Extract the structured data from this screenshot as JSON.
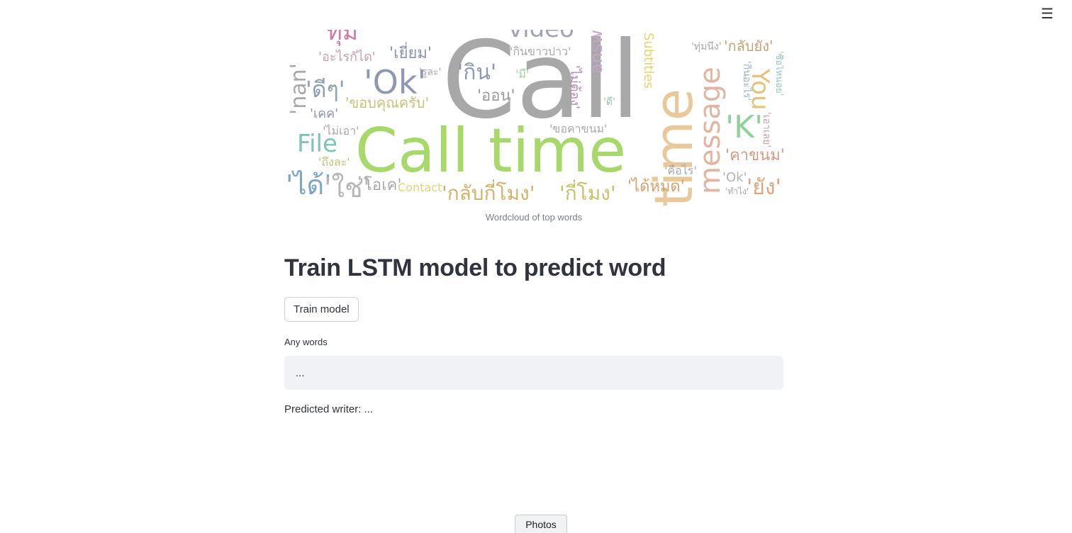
{
  "header": {
    "menu_icon": "hamburger-menu-icon",
    "menu_glyph": "☰"
  },
  "wordcloud": {
    "caption": "Wordcloud of top words",
    "words": [
      {
        "text": "Call",
        "color": "#a8a8a8"
      },
      {
        "text": "'Call",
        "color": "#b0b0b0"
      },
      {
        "text": "Call time",
        "color": "#a7d96a"
      },
      {
        "text": "time",
        "color": "#e9c89a"
      },
      {
        "text": "message",
        "color": "#e2b5a0"
      },
      {
        "text": "'Ok'",
        "color": "#8e98b0"
      },
      {
        "text": "File",
        "color": "#7fc3b9"
      },
      {
        "text": "'K'",
        "color": "#8fd19a"
      },
      {
        "text": "You",
        "color": "#e6c27a"
      },
      {
        "text": "video",
        "color": "#9ea4b6"
      },
      {
        "text": "answer",
        "color": "#c9a4c9"
      },
      {
        "text": "'nan'",
        "color": "#a9a9a9"
      },
      {
        "text": "'ได้'",
        "color": "#7aa7c9"
      },
      {
        "text": "'ใช่'",
        "color": "#b7b7b7"
      },
      {
        "text": "'ดีๆ'",
        "color": "#8ea0b3"
      },
      {
        "text": "'กลับกี่โมง'",
        "color": "#d3b26a"
      },
      {
        "text": "'กี่โมง'",
        "color": "#c9c06a"
      },
      {
        "text": "'ขอบคุณครับ'",
        "color": "#c8c27a"
      },
      {
        "text": "'ยัง'",
        "color": "#e2a27a"
      },
      {
        "text": "'คาขนม'",
        "color": "#d69a82"
      },
      {
        "text": "'กิน'",
        "color": "#8c9ab0"
      },
      {
        "text": "'ออน'",
        "color": "#9a9a9a"
      },
      {
        "text": "'เยี่ยม'",
        "color": "#8a93b5"
      },
      {
        "text": "'อะไรกัได'",
        "color": "#c6a0b0"
      },
      {
        "text": "'ได้หมด'",
        "color": "#d6a36a"
      },
      {
        "text": "'โอเค'",
        "color": "#a9a9a9"
      },
      {
        "text": "Contact",
        "color": "#e6d07a"
      },
      {
        "text": "'กลับยัง'",
        "color": "#c3a472"
      },
      {
        "text": "'ทุ่ม'",
        "color": "#cf7aa9"
      },
      {
        "text": "'ไม่ต้อง'",
        "color": "#b08ab5"
      },
      {
        "text": "'ขอคาขนม'",
        "color": "#a9a9a9"
      },
      {
        "text": "'ถึงละ'",
        "color": "#c7c27a"
      },
      {
        "text": "'เคค'",
        "color": "#8f98b0"
      },
      {
        "text": "'ไม่เอา'",
        "color": "#a9a9a9"
      },
      {
        "text": "'คือไร'",
        "color": "#a9a9a9"
      },
      {
        "text": "Subtitles",
        "color": "#e7d36a"
      },
      {
        "text": "'กินขาวปาว'",
        "color": "#a9a9a9"
      },
      {
        "text": "'ทำไง'",
        "color": "#a9a9a9"
      },
      {
        "text": "'Ok'",
        "color": "#b4b4b4"
      },
      {
        "text": "'กินอะไร'",
        "color": "#9ab0c9"
      },
      {
        "text": "'เอาเลย'",
        "color": "#c9a0a0"
      },
      {
        "text": "'ซื้อไหนอย'",
        "color": "#8fc9c0"
      },
      {
        "text": "'ทุ่มนึง'",
        "color": "#a9a9a9"
      },
      {
        "text": "'รูละ'",
        "color": "#a9a9a9"
      },
      {
        "text": "'มี'",
        "color": "#9fd19a"
      },
      {
        "text": "'ดี'",
        "color": "#8fc9a0"
      }
    ]
  },
  "section": {
    "title": "Train LSTM model to predict word"
  },
  "train_button": {
    "label": "Train model"
  },
  "input": {
    "label": "Any words",
    "value": "..."
  },
  "prediction": {
    "text": "Predicted writer: ..."
  },
  "bottom_tab": {
    "label": "Photos"
  }
}
